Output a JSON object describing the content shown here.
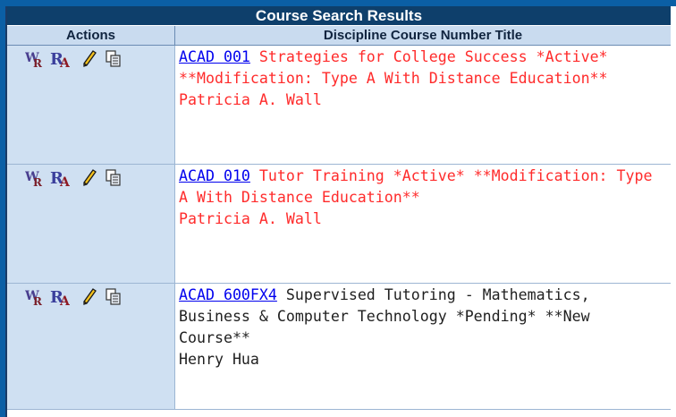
{
  "panel": {
    "title": "Course Search Results",
    "columns": {
      "actions": "Actions",
      "title": "Discipline Course Number Title"
    }
  },
  "results": [
    {
      "code": "ACAD 001",
      "desc": " Strategies for College Success *Active* **Modification: Type A With Distance Education**",
      "author": "Patricia A. Wall",
      "style": "red"
    },
    {
      "code": "ACAD 010",
      "desc": " Tutor Training *Active* **Modification: Type A With Distance Education**",
      "author": "Patricia A. Wall",
      "style": "red"
    },
    {
      "code": "ACAD 600FX4",
      "desc": " Supervised Tutoring - Mathematics, Business & Computer Technology *Pending* **New Course**",
      "author": "Henry Hua",
      "style": "black"
    }
  ],
  "icons": [
    "view-report-icon",
    "report-analysis-icon",
    "edit-pencil-icon",
    "copy-icon"
  ],
  "colors": {
    "frame": "#0b5fa5",
    "title_bar": "#0e3f6b",
    "header": "#c9dbef",
    "red_text": "#ff2b2b",
    "link": "#0000ee"
  }
}
